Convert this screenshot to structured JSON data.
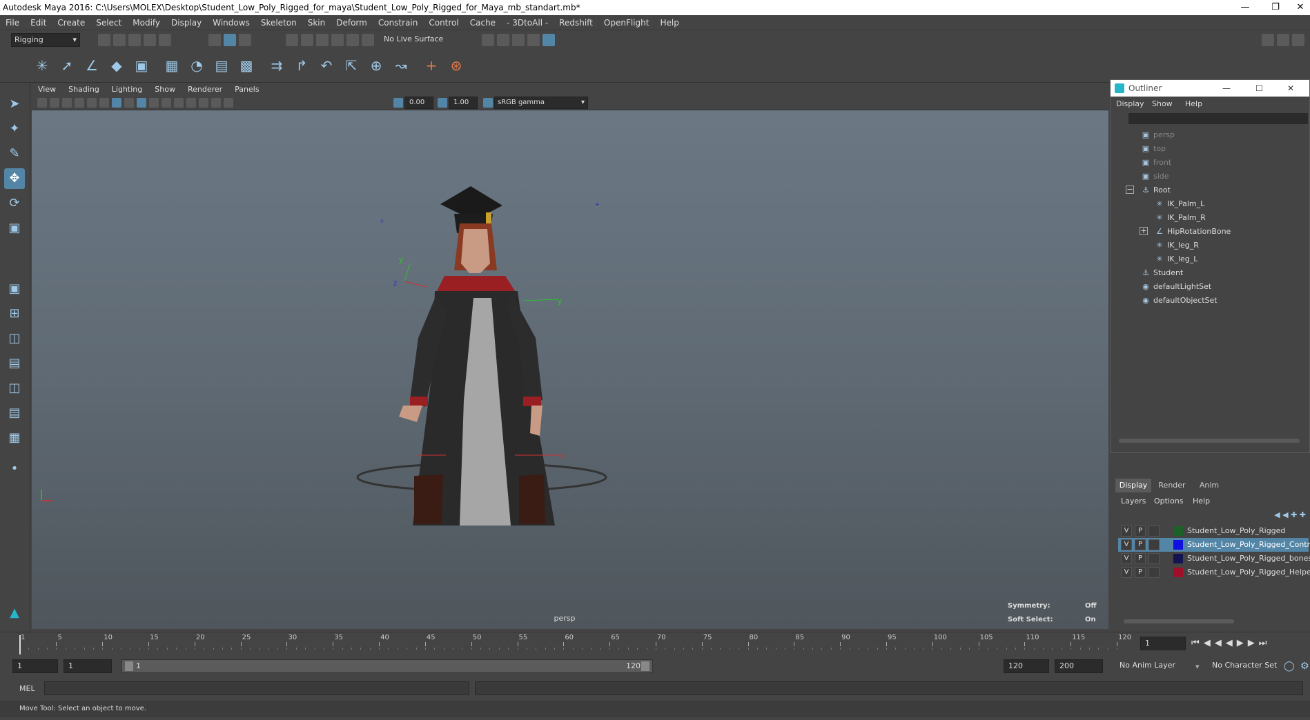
{
  "window": {
    "title": "Autodesk Maya 2016: C:\\Users\\MOLEX\\Desktop\\Student_Low_Poly_Rigged_for_maya\\Student_Low_Poly_Rigged_for_Maya_mb_standart.mb*"
  },
  "menubar": [
    "File",
    "Edit",
    "Create",
    "Select",
    "Modify",
    "Display",
    "Windows",
    "Skeleton",
    "Skin",
    "Deform",
    "Constrain",
    "Control",
    "Cache",
    "- 3DtoAll -",
    "Redshift",
    "OpenFlight",
    "Help"
  ],
  "status": {
    "menuset": "Rigging",
    "live_surface": "No Live Surface"
  },
  "viewport": {
    "menu": [
      "View",
      "Shading",
      "Lighting",
      "Show",
      "Renderer",
      "Panels"
    ],
    "exposure": "0.00",
    "gamma": "1.00",
    "color_space": "sRGB gamma",
    "camera": "persp",
    "symmetry_label": "Symmetry:",
    "symmetry_value": "Off",
    "soft_select_label": "Soft Select:",
    "soft_select_value": "On"
  },
  "outliner": {
    "title": "Outliner",
    "menu": [
      "Display",
      "Show",
      "Help"
    ],
    "items": [
      {
        "label": "persp",
        "icon": "camera-icon",
        "dim": true
      },
      {
        "label": "top",
        "icon": "camera-icon",
        "dim": true
      },
      {
        "label": "front",
        "icon": "camera-icon",
        "dim": true
      },
      {
        "label": "side",
        "icon": "camera-icon",
        "dim": true
      },
      {
        "label": "Root",
        "icon": "group-icon"
      },
      {
        "label": "IK_Palm_L",
        "icon": "ik-handle-icon"
      },
      {
        "label": "IK_Palm_R",
        "icon": "ik-handle-icon"
      },
      {
        "label": "HipRotationBone",
        "icon": "joint-icon"
      },
      {
        "label": "IK_leg_R",
        "icon": "ik-handle-icon"
      },
      {
        "label": "IK_leg_L",
        "icon": "ik-handle-icon"
      },
      {
        "label": "Student",
        "icon": "group-icon"
      },
      {
        "label": "defaultLightSet",
        "icon": "set-icon"
      },
      {
        "label": "defaultObjectSet",
        "icon": "set-icon"
      }
    ]
  },
  "layer_editor": {
    "tabs": [
      "Display",
      "Render",
      "Anim"
    ],
    "menu": [
      "Layers",
      "Options",
      "Help"
    ],
    "layers": [
      {
        "v": "V",
        "p": "P",
        "name": "Student_Low_Poly_Rigged",
        "color": "#1f5f2a",
        "selected": false
      },
      {
        "v": "V",
        "p": "P",
        "name": "Student_Low_Poly_Rigged_Controllers",
        "color": "#1010e0",
        "selected": true
      },
      {
        "v": "V",
        "p": "P",
        "name": "Student_Low_Poly_Rigged_bones",
        "color": "#141450",
        "selected": false
      },
      {
        "v": "V",
        "p": "P",
        "name": "Student_Low_Poly_Rigged_Helpers",
        "color": "#a0102a",
        "selected": false
      }
    ]
  },
  "timeline": {
    "ticks": [
      "1",
      "5",
      "10",
      "15",
      "20",
      "25",
      "30",
      "35",
      "40",
      "45",
      "50",
      "55",
      "60",
      "65",
      "70",
      "75",
      "80",
      "85",
      "90",
      "95",
      "100",
      "105",
      "110",
      "115",
      "120"
    ],
    "current_frame": "1"
  },
  "range": {
    "start": "1",
    "playback_start": "1",
    "slider_start": "1",
    "slider_end": "120",
    "playback_end": "120",
    "end": "200",
    "anim_layer": "No Anim Layer",
    "character_set": "No Character Set"
  },
  "cmdline": {
    "label": "MEL"
  },
  "help_line": "Move Tool: Select an object to move."
}
